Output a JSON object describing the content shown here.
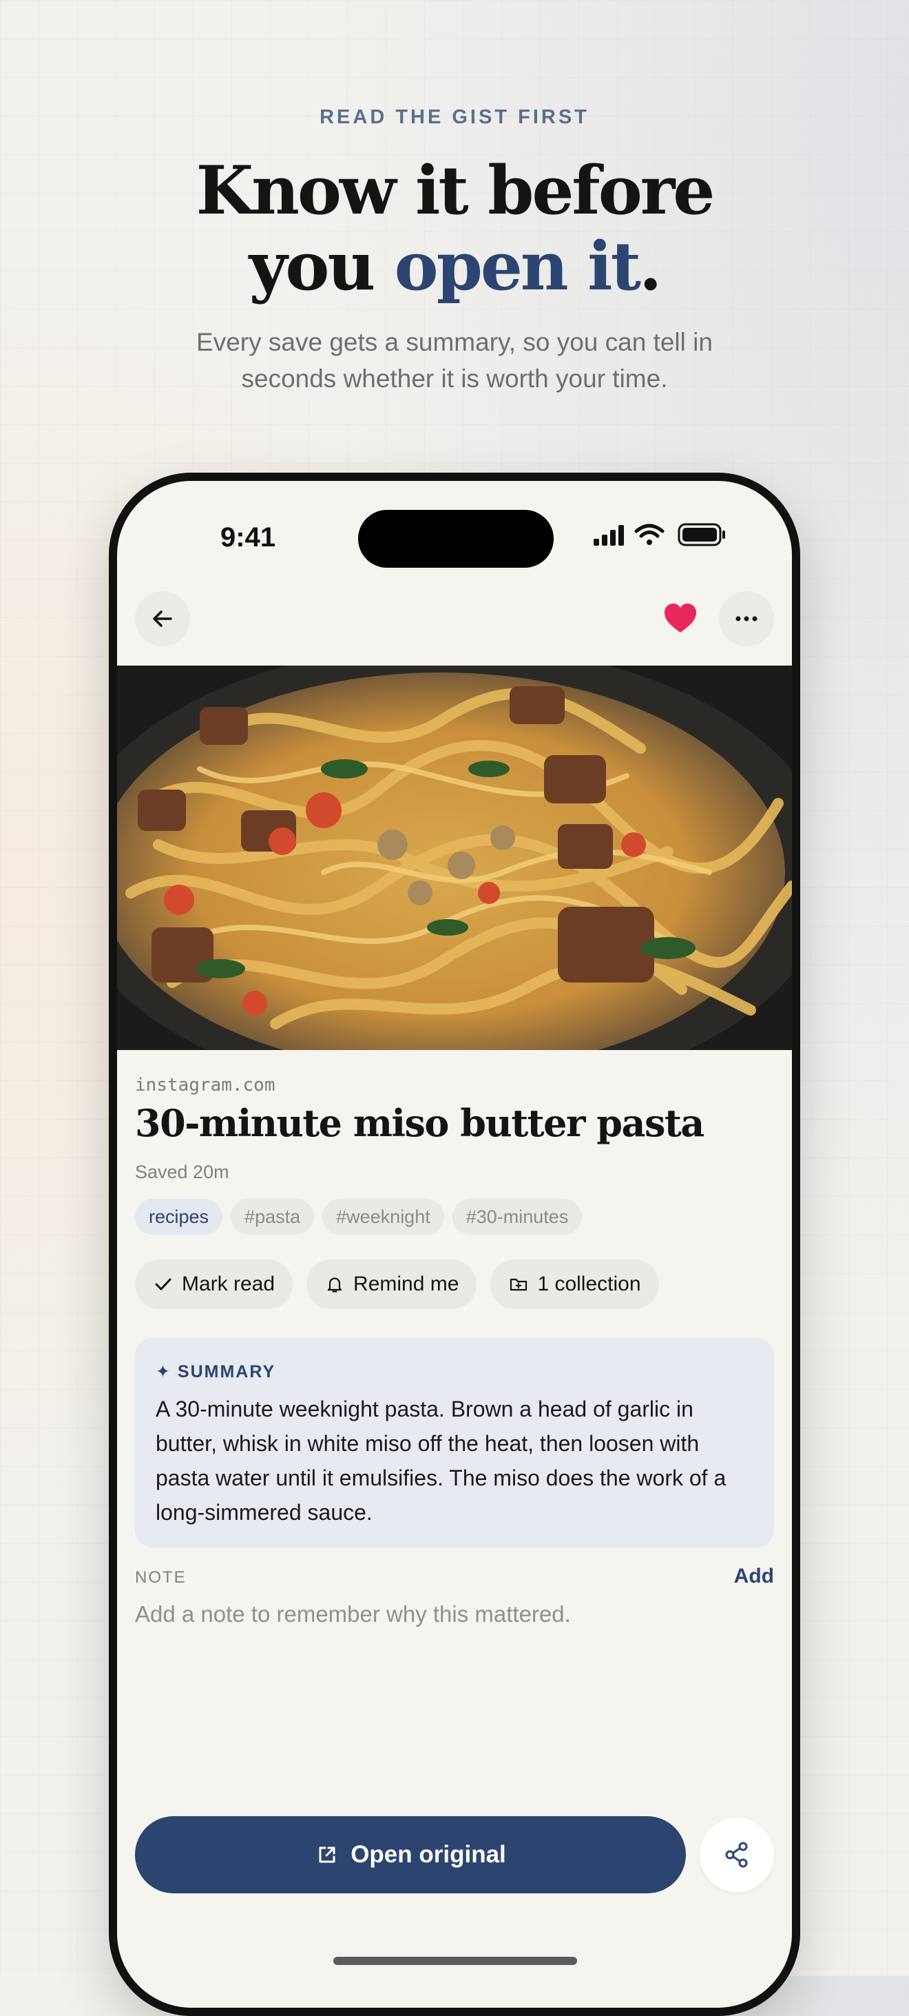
{
  "marketing": {
    "eyebrow": "READ THE GIST FIRST",
    "headline_line1": "Know it before",
    "headline_line2_prefix": "you ",
    "headline_line2_accent": "open it",
    "headline_line2_suffix": ".",
    "subhead_line1": "Every save gets a summary, so you can tell in",
    "subhead_line2": "seconds whether it is worth your time."
  },
  "status_bar": {
    "time": "9:41"
  },
  "top_bar": {
    "back_icon": "arrow-left-icon",
    "favorite_icon": "heart-icon",
    "more_icon": "more-horizontal-icon"
  },
  "item": {
    "domain": "instagram.com",
    "title": "30-minute miso butter pasta",
    "saved": "Saved 20m",
    "tags": [
      {
        "label": "recipes"
      },
      {
        "label": "#pasta"
      },
      {
        "label": "#weeknight"
      },
      {
        "label": "#30-minutes"
      }
    ]
  },
  "actions": {
    "mark_read": "Mark read",
    "remind": "Remind me",
    "collection": "1 collection"
  },
  "summary": {
    "label": "SUMMARY",
    "text": "A 30-minute weeknight pasta. Brown a head of garlic in butter, whisk in white miso off the heat, then loosen with pasta water until it emulsifies. The miso does the work of a long-simmered sauce."
  },
  "note": {
    "label": "NOTE",
    "add": "Add",
    "placeholder": "Add a note to remember why this mattered."
  },
  "footer": {
    "open_original": "Open original",
    "share_icon": "share-icon"
  },
  "colors": {
    "accent": "#2c4470",
    "heart": "#e8285a",
    "screen_bg": "#f6f4ef"
  }
}
